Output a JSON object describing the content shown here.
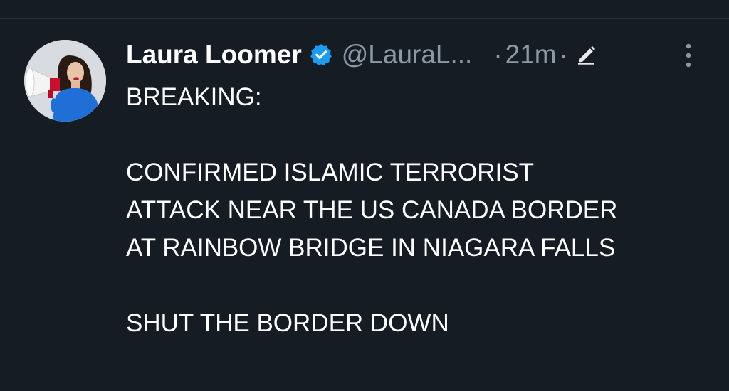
{
  "post": {
    "author": {
      "display_name": "Laura Loomer",
      "handle": "@LauraL...",
      "verified": true,
      "avatar_icon": "person-with-megaphone-avatar"
    },
    "separator": "·",
    "timestamp": "21m",
    "edited_icon": "pencil-icon",
    "more_icon": "vertical-ellipsis-icon",
    "lines": {
      "l1": "BREAKING:",
      "l2": "CONFIRMED ISLAMIC TERRORIST",
      "l3": "ATTACK NEAR THE US CANADA BORDER",
      "l4": "AT RAINBOW BRIDGE IN NIAGARA FALLS",
      "l5": "SHUT THE BORDER DOWN"
    }
  },
  "colors": {
    "background": "#161c23",
    "text": "#ffffff",
    "muted": "#8b98a5",
    "verified": "#1d9bf0"
  }
}
